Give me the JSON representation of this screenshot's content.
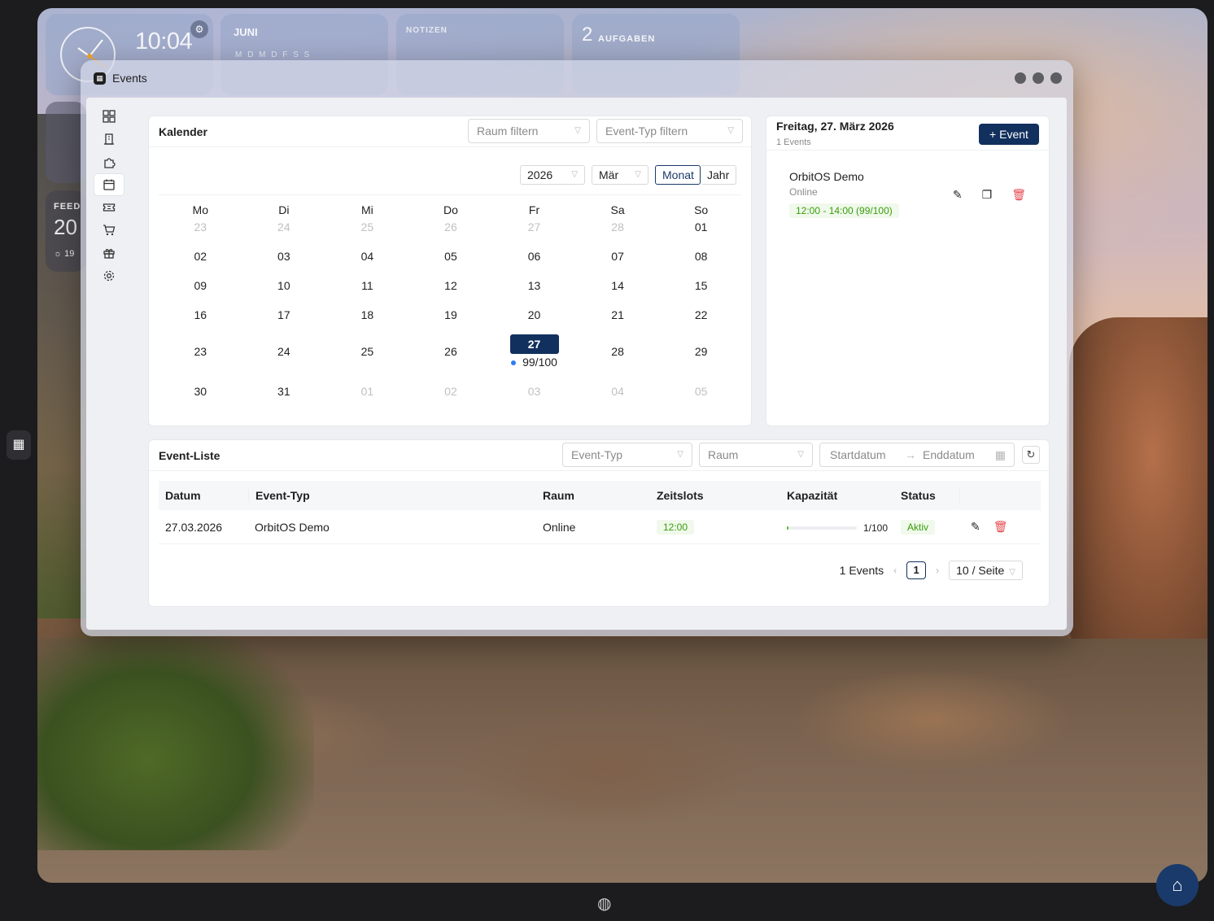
{
  "widgets": {
    "clock_time": "10:04",
    "month_name": "JUNI",
    "month_days": "M D M D F S S",
    "notes_title": "NOTIZEN",
    "tasks_count": "2",
    "tasks_label": "AUFGABEN",
    "feed_label": "FEED",
    "feed_number": "20",
    "feed_sub": "19"
  },
  "window": {
    "title": "Events"
  },
  "nav": {
    "items": [
      "dashboard",
      "building",
      "puzzle",
      "calendar",
      "ticket",
      "cart",
      "gift",
      "settings"
    ],
    "active": "calendar"
  },
  "calendar": {
    "title": "Kalender",
    "room_filter_placeholder": "Raum filtern",
    "type_filter_placeholder": "Event-Typ filtern",
    "year": "2026",
    "month": "Mär",
    "mode_month": "Monat",
    "mode_year": "Jahr",
    "weekdays": [
      "Mo",
      "Di",
      "Mi",
      "Do",
      "Fr",
      "Sa",
      "So"
    ],
    "weeks": [
      [
        {
          "d": "23",
          "dim": true
        },
        {
          "d": "24",
          "dim": true
        },
        {
          "d": "25",
          "dim": true
        },
        {
          "d": "26",
          "dim": true
        },
        {
          "d": "27",
          "dim": true
        },
        {
          "d": "28",
          "dim": true
        },
        {
          "d": "01"
        }
      ],
      [
        {
          "d": "02"
        },
        {
          "d": "03"
        },
        {
          "d": "04"
        },
        {
          "d": "05"
        },
        {
          "d": "06"
        },
        {
          "d": "07"
        },
        {
          "d": "08"
        }
      ],
      [
        {
          "d": "09"
        },
        {
          "d": "10"
        },
        {
          "d": "11"
        },
        {
          "d": "12"
        },
        {
          "d": "13"
        },
        {
          "d": "14"
        },
        {
          "d": "15"
        }
      ],
      [
        {
          "d": "16"
        },
        {
          "d": "17"
        },
        {
          "d": "18"
        },
        {
          "d": "19"
        },
        {
          "d": "20"
        },
        {
          "d": "21"
        },
        {
          "d": "22"
        }
      ],
      [
        {
          "d": "23"
        },
        {
          "d": "24"
        },
        {
          "d": "25"
        },
        {
          "d": "26"
        },
        {
          "d": "27",
          "selected": true,
          "badge": "99/100"
        },
        {
          "d": "28"
        },
        {
          "d": "29"
        }
      ],
      [
        {
          "d": "30"
        },
        {
          "d": "31"
        },
        {
          "d": "01",
          "dim": true
        },
        {
          "d": "02",
          "dim": true
        },
        {
          "d": "03",
          "dim": true
        },
        {
          "d": "04",
          "dim": true
        },
        {
          "d": "05",
          "dim": true
        }
      ]
    ]
  },
  "day_panel": {
    "title": "Freitag, 27. März 2026",
    "subtitle": "1 Events",
    "add_button": "Event",
    "event": {
      "name": "OrbitOS Demo",
      "room": "Online",
      "slot": "12:00 - 14:00 (99/100)"
    }
  },
  "event_list": {
    "title": "Event-Liste",
    "type_placeholder": "Event-Typ",
    "room_placeholder": "Raum",
    "start_placeholder": "Startdatum",
    "end_placeholder": "Enddatum",
    "columns": [
      "Datum",
      "Event-Typ",
      "Raum",
      "Zeitslots",
      "Kapazität",
      "Status"
    ],
    "rows": [
      {
        "date": "27.03.2026",
        "type": "OrbitOS Demo",
        "room": "Online",
        "slot": "12:00",
        "capacity_text": "1/100",
        "capacity_fraction": 0.01,
        "status": "Aktiv"
      }
    ],
    "pager": {
      "total": "1 Events",
      "page": "1",
      "size": "10 / Seite"
    }
  },
  "colors": {
    "primary": "#12305e",
    "success": "#389e0d",
    "danger": "#e5484d"
  }
}
